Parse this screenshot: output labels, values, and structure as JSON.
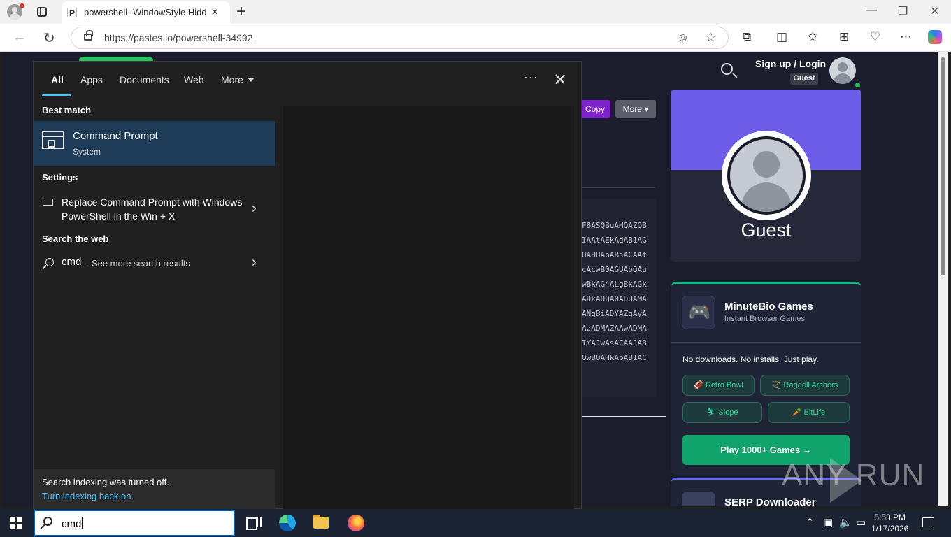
{
  "browser": {
    "tab_title": "powershell -WindowStyle Hidden",
    "tab_favicon": "P",
    "url": "https://pastes.io/powershell-34992"
  },
  "site": {
    "signup": "Sign up / Login",
    "guest_badge": "Guest",
    "copy_btn": "Copy",
    "more_btn": "More ▾",
    "code_lines": [
      "F8ASQBuAHQAZQB",
      "IAAtAEkAdAB1AG",
      "OAHUAbABsACAAf",
      "cAcwB0AGUAbQAu",
      "wBkAG4ALgBkAGk",
      "ADkAOQA0ADUAMA",
      "ANgBiADYAZgAyA",
      "AzADMAZAAwADMA",
      "IYAJwAsACAAJAB",
      "OwB0AHkAbAB1AC"
    ],
    "profile": {
      "name": "Guest"
    },
    "games": {
      "title": "MinuteBio Games",
      "subtitle": "Instant Browser Games",
      "tagline": "No downloads. No installs. Just play.",
      "chips": [
        "🏈 Retro Bowl",
        "🏹 Ragdoll Archers",
        "⛷ Slope",
        "🥕 BitLife"
      ],
      "play": "Play 1000+ Games →"
    },
    "serp": {
      "title": "SERP Downloader"
    },
    "watermark": "ANY RUN"
  },
  "search": {
    "tabs": [
      "All",
      "Apps",
      "Documents",
      "Web",
      "More"
    ],
    "best_match_heading": "Best match",
    "best_match": {
      "title": "Command Prompt",
      "subtitle": "System"
    },
    "settings_heading": "Settings",
    "setting_item": "Replace Command Prompt with Windows PowerShell in the Win + X",
    "web_heading": "Search the web",
    "web_query": "cmd",
    "web_more": "- See more search results",
    "index_text": "Search indexing was turned off.",
    "index_link": "Turn indexing back on.",
    "query": "cmd"
  },
  "taskbar": {
    "time": "5:53 PM",
    "date": "1/17/2026"
  },
  "colors": {
    "accent": "#4cc2ff",
    "selection": "#1e3b57",
    "purple": "#6c5ce7",
    "green": "#10a36b"
  }
}
